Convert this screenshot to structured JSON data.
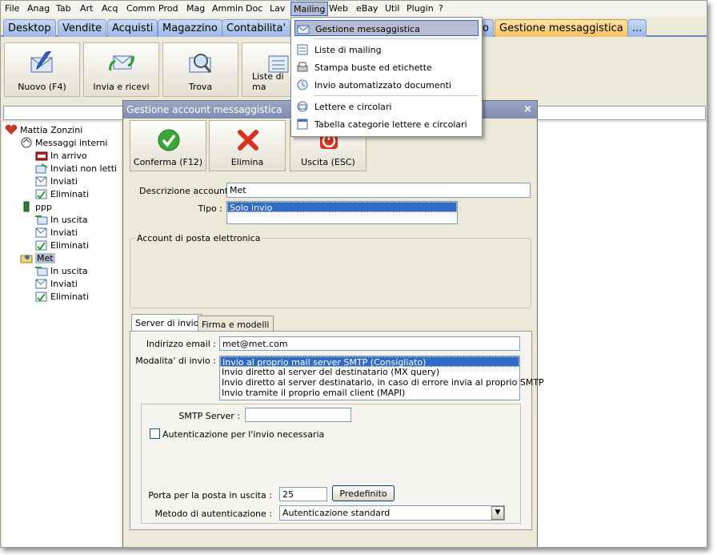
{
  "menubar": [
    "File",
    "Anag",
    "Tab",
    "Art",
    "Acq",
    "Comm",
    "Prod",
    "Mag",
    "Ammin",
    "Doc",
    "Lav",
    "Mailing",
    "Web",
    "eBay",
    "Util",
    "Plugin",
    "?"
  ],
  "tabs": [
    "Desktop",
    "Vendite",
    "Acquisti",
    "Magazzino",
    "Contabilita'",
    "o",
    "Gestione messaggistica",
    "..."
  ],
  "toolbar": {
    "new": "Nuovo (F4)",
    "send": "Invia e ricevi",
    "find": "Trova",
    "lists": "Liste di ma"
  },
  "tree": {
    "root": "Mattia Zonzini",
    "internal": "Messaggi interni",
    "in_arrivo": "In arrivo",
    "non_letti": "Inviati non letti",
    "inviati": "Inviati",
    "eliminati": "Eliminati",
    "ppp": "ppp",
    "in_uscita": "In uscita",
    "met": "Met"
  },
  "menu_items": [
    "Gestione messaggistica",
    "Liste di mailing",
    "Stampa buste ed etichette",
    "Invio automatizzato documenti",
    "Lettere e circolari",
    "Tabella categorie lettere e circolari"
  ],
  "dialog": {
    "title": "Gestione account messaggistica",
    "confirm": "Conferma (F12)",
    "delete": "Elimina",
    "exit": "Uscita (ESC)",
    "desc_label": "Descrizione account :",
    "desc_value": "Met",
    "type_label": "Tipo :",
    "type_value": "Solo invio",
    "email_group": "Account di posta elettronica",
    "tab_server": "Server di invio",
    "tab_sign": "Firma e modelli",
    "email_label": "Indirizzo email :",
    "email_value": "met@met.com",
    "mode_label": "Modalita' di invio :",
    "modes": [
      "Invio al proprio mail server SMTP (Consigliato)",
      "Invio diretto al server del destinatario (MX query)",
      "Invio diretto al server destinatario, in caso di errore invia al proprio SMTP",
      "Invio tramite il proprio email client (MAPI)"
    ],
    "smtp_label": "SMTP Server :",
    "smtp_value": "",
    "auth_label": "Autenticazione per l'invio necessaria",
    "port_label": "Porta per la posta in uscita :",
    "port_value": "25",
    "default_btn": "Predefinito",
    "method_label": "Metodo di autenticazione :",
    "method_value": "Autenticazione standard"
  },
  "colors": {
    "tab": "#9db7e6",
    "tab_selected": "#f7c25f",
    "selection": "#316ac5",
    "title": "#7f8cad"
  }
}
